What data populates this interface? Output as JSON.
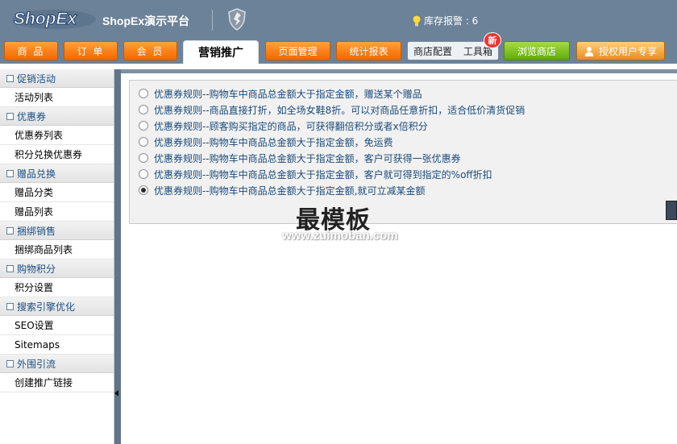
{
  "header": {
    "logo_text": "ShopEx",
    "platform_title": "ShopEx演示平台",
    "stock_alert": "库存报警 : 6"
  },
  "nav": {
    "tabs": [
      {
        "label": "商 品"
      },
      {
        "label": "订 单"
      },
      {
        "label": "会 员"
      },
      {
        "label": "营销推广"
      },
      {
        "label": "页面管理"
      },
      {
        "label": "统计报表"
      },
      {
        "label": "商店配置"
      },
      {
        "label": "工具箱"
      },
      {
        "label": "浏览商店"
      },
      {
        "label": "授权用户专享"
      }
    ],
    "new_badge": "新"
  },
  "sidebar": {
    "groups": [
      {
        "title": "促销活动",
        "items": [
          "活动列表"
        ]
      },
      {
        "title": "优惠券",
        "items": [
          "优惠券列表",
          "积分兑换优惠券"
        ]
      },
      {
        "title": "赠品兑换",
        "items": [
          "赠品分类",
          "赠品列表"
        ]
      },
      {
        "title": "捆绑销售",
        "items": [
          "捆绑商品列表"
        ]
      },
      {
        "title": "购物积分",
        "items": [
          "积分设置"
        ]
      },
      {
        "title": "搜索引擎优化",
        "items": [
          "SEO设置",
          "Sitemaps"
        ]
      },
      {
        "title": "外围引流",
        "items": [
          "创建推广链接"
        ]
      }
    ]
  },
  "main": {
    "options": [
      {
        "label": "优惠券规则--购物车中商品总金额大于指定金额，赠送某个赠品",
        "checked": false
      },
      {
        "label": "优惠券规则--商品直接打折，如全场女鞋8折。可以对商品任意折扣，适合低价清货促销",
        "checked": false
      },
      {
        "label": "优惠券规则--顾客购买指定的商品，可获得翻倍积分或者x倍积分",
        "checked": false
      },
      {
        "label": "优惠券规则--购物车中商品总金额大于指定金额，免运费",
        "checked": false
      },
      {
        "label": "优惠券规则--购物车中商品总金额大于指定金额，客户可获得一张优惠券",
        "checked": false
      },
      {
        "label": "优惠券规则--购物车中商品总金额大于指定金额，客户就可得到指定的%off折扣",
        "checked": false
      },
      {
        "label": "优惠券规则--购物车中商品总金额大于指定金额,就可立减某金额",
        "checked": true
      }
    ]
  },
  "watermark": {
    "title": "最模板",
    "url": "www.zuimoban.com"
  },
  "colors": {
    "header_bg": "#6b8299",
    "nav_orange": "#fb7f17",
    "link_blue": "#1a4a7a"
  }
}
